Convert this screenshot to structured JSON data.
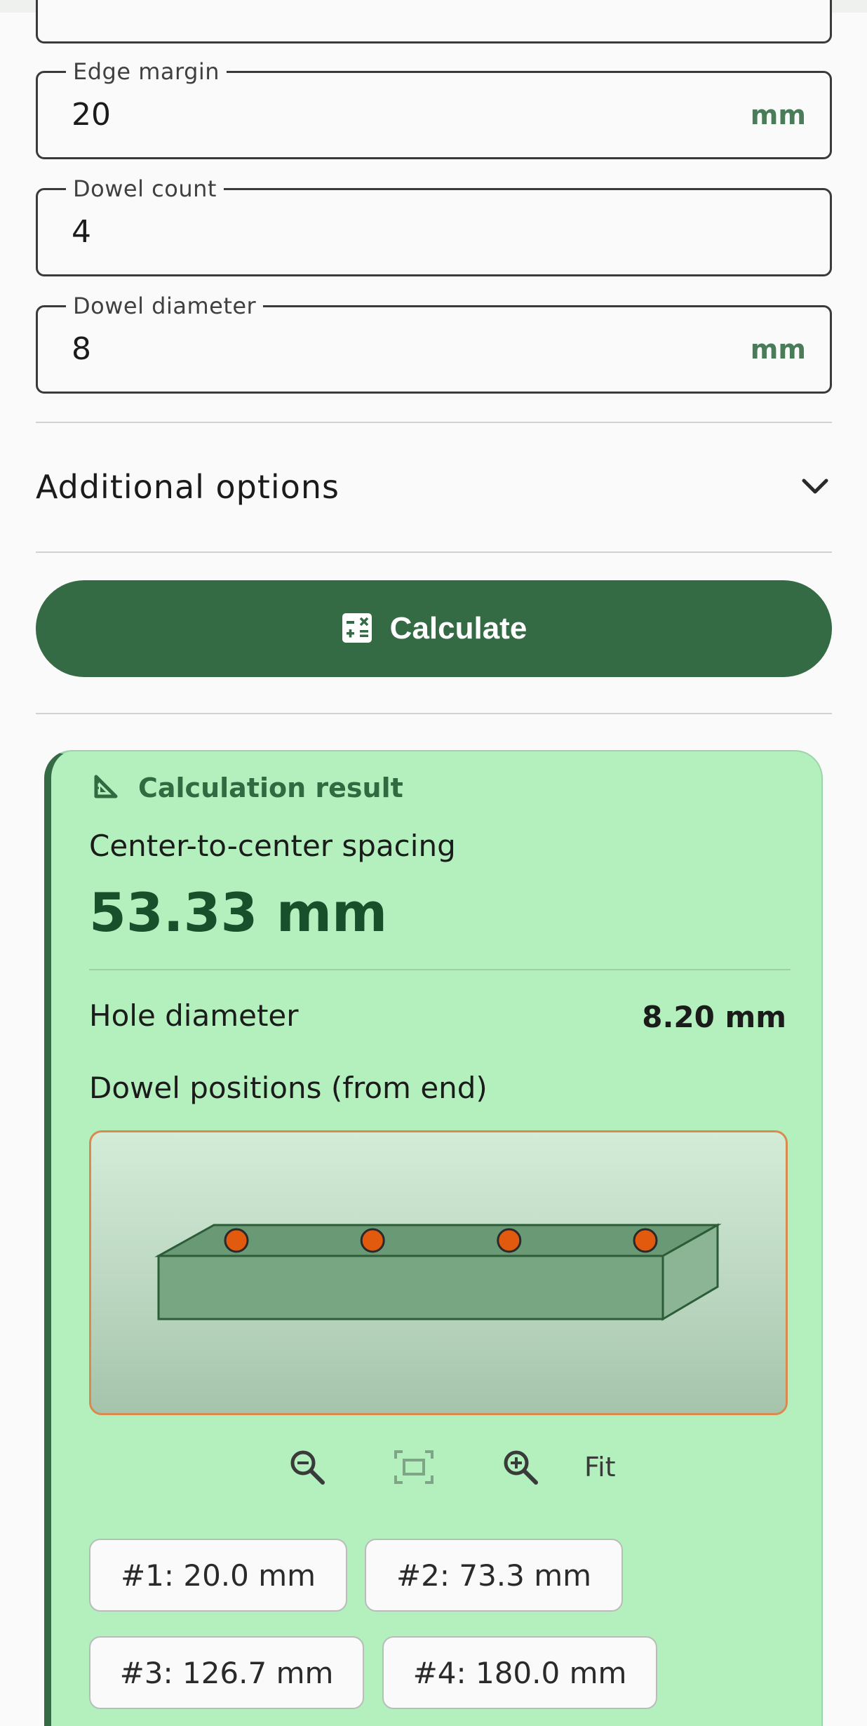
{
  "fields": [
    {
      "label": "Edge margin",
      "value": "20",
      "unit": "mm"
    },
    {
      "label": "Dowel count",
      "value": "4",
      "unit": ""
    },
    {
      "label": "Dowel diameter",
      "value": "8",
      "unit": "mm"
    }
  ],
  "options": {
    "label": "Additional options",
    "icon": "chevron-down-icon"
  },
  "calculate": {
    "label": "Calculate",
    "icon": "calculator-icon"
  },
  "result": {
    "heading": "Calculation result",
    "heading_icon": "set-square-icon",
    "spacing_label": "Center-to-center spacing",
    "spacing_value": "53.33 mm",
    "hole_label": "Hole diameter",
    "hole_value": "8.20 mm",
    "positions_label": "Dowel positions (from end)",
    "fit_label": "Fit",
    "positions": [
      "#1: 20.0 mm",
      "#2: 73.3 mm",
      "#3: 126.7 mm",
      "#4: 180.0 mm"
    ]
  },
  "colors": {
    "accent": "#346b45",
    "result_bg": "#b3f0bd",
    "dowel": "#e25a0e",
    "unit_text": "#4a7c59",
    "diagram_border": "#d98a4e"
  }
}
